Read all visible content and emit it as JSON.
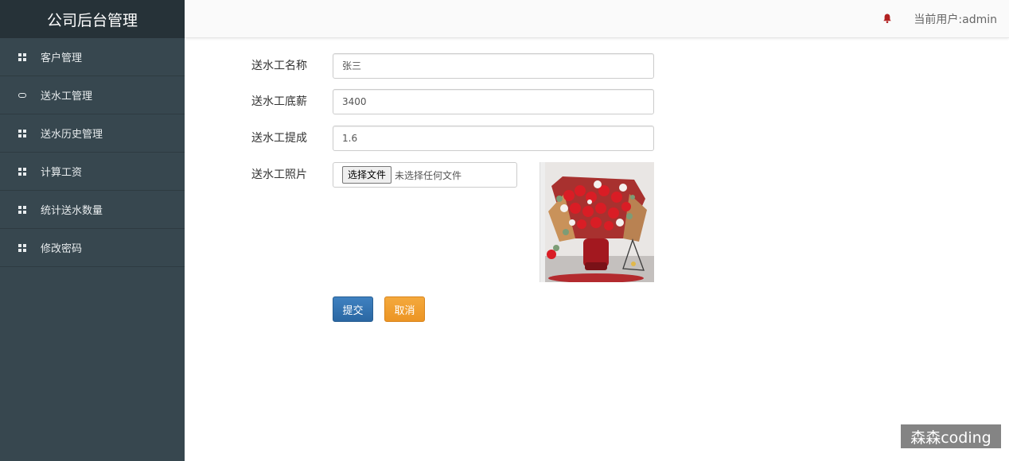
{
  "sidebar": {
    "brand": "公司后台管理",
    "items": [
      {
        "label": "客户管理",
        "icon": "grid-icon"
      },
      {
        "label": "送水工管理",
        "icon": "link-icon"
      },
      {
        "label": "送水历史管理",
        "icon": "grid-icon"
      },
      {
        "label": "计算工资",
        "icon": "grid-icon"
      },
      {
        "label": "统计送水数量",
        "icon": "grid-icon"
      },
      {
        "label": "修改密码",
        "icon": "grid-icon"
      }
    ]
  },
  "header": {
    "current_user": "当前用户:admin",
    "bell_color": "#b22222"
  },
  "form": {
    "name_label": "送水工名称",
    "name_value": "张三",
    "salary_label": "送水工底薪",
    "salary_value": "3400",
    "commission_label": "送水工提成",
    "commission_value": "1.6",
    "photo_label": "送水工照片",
    "file_button": "选择文件",
    "file_status": "未选择任何文件",
    "photo_alt": "bouquet of red roses"
  },
  "actions": {
    "submit": "提交",
    "cancel": "取消",
    "submit_color": "#2d6aa6",
    "cancel_color": "#f0a030"
  },
  "watermark": "森森coding"
}
